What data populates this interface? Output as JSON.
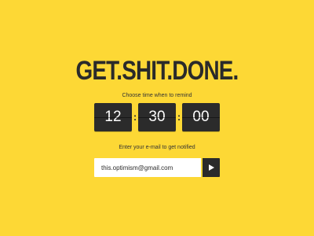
{
  "title": "GET.SHIT.DONE.",
  "time_prompt": "Choose time when to remind",
  "timer": {
    "hours": "12",
    "minutes": "30",
    "seconds": "00",
    "separator": ":"
  },
  "email_prompt": "Enter your e-mail to get notified",
  "email": {
    "value": "this.optimism@gmail.com"
  },
  "submit_icon": "play-icon",
  "colors": {
    "background": "#FDD835",
    "dark": "#2b2b2b",
    "input_bg": "#ffffff"
  }
}
